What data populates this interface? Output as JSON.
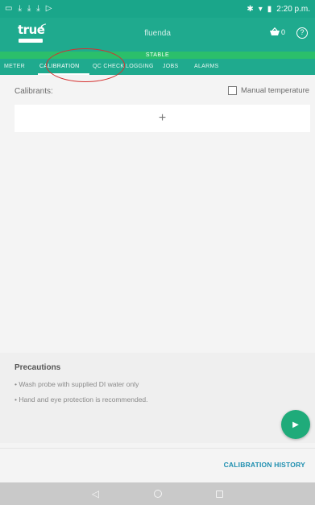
{
  "status_bar": {
    "left_icons": [
      "notification-icon",
      "download-icon",
      "download-icon",
      "download-icon",
      "play-store-icon"
    ],
    "left_glyphs": [
      "▭",
      "⤓",
      "⤓",
      "⤓",
      "▷"
    ],
    "bluetooth": "✱",
    "wifi": "▾",
    "battery": "▮",
    "time": "2:20 p.m."
  },
  "app_bar": {
    "logo_text": "true",
    "device_name": "fluenda",
    "cart_icon": "⌂",
    "cart_count": "0",
    "help_glyph": "?"
  },
  "stable_label": "STABLE",
  "tabs": [
    {
      "label": "METER"
    },
    {
      "label": "CALIBRATION"
    },
    {
      "label": "QC CHECK"
    },
    {
      "label": "LOGGING"
    },
    {
      "label": "JOBS"
    },
    {
      "label": "ALARMS"
    }
  ],
  "active_tab_index": 1,
  "calibrants_label": "Calibrants:",
  "manual_temperature": {
    "label": "Manual temperature",
    "checked": false
  },
  "add_calibrant_glyph": "+",
  "precautions": {
    "title": "Precautions",
    "items": [
      "• Wash probe with supplied DI water only",
      "• Hand and eye protection is recommended."
    ]
  },
  "start_button_glyph": "▶",
  "calibration_history_label": "CALIBRATION HISTORY",
  "nav": {
    "back": "◁"
  },
  "colors": {
    "primary": "#1faa8e",
    "stable_green": "#2bbf6b",
    "fab": "#1fab7a",
    "link_blue": "#1f8fb0",
    "annotation_red": "#d5302f"
  }
}
